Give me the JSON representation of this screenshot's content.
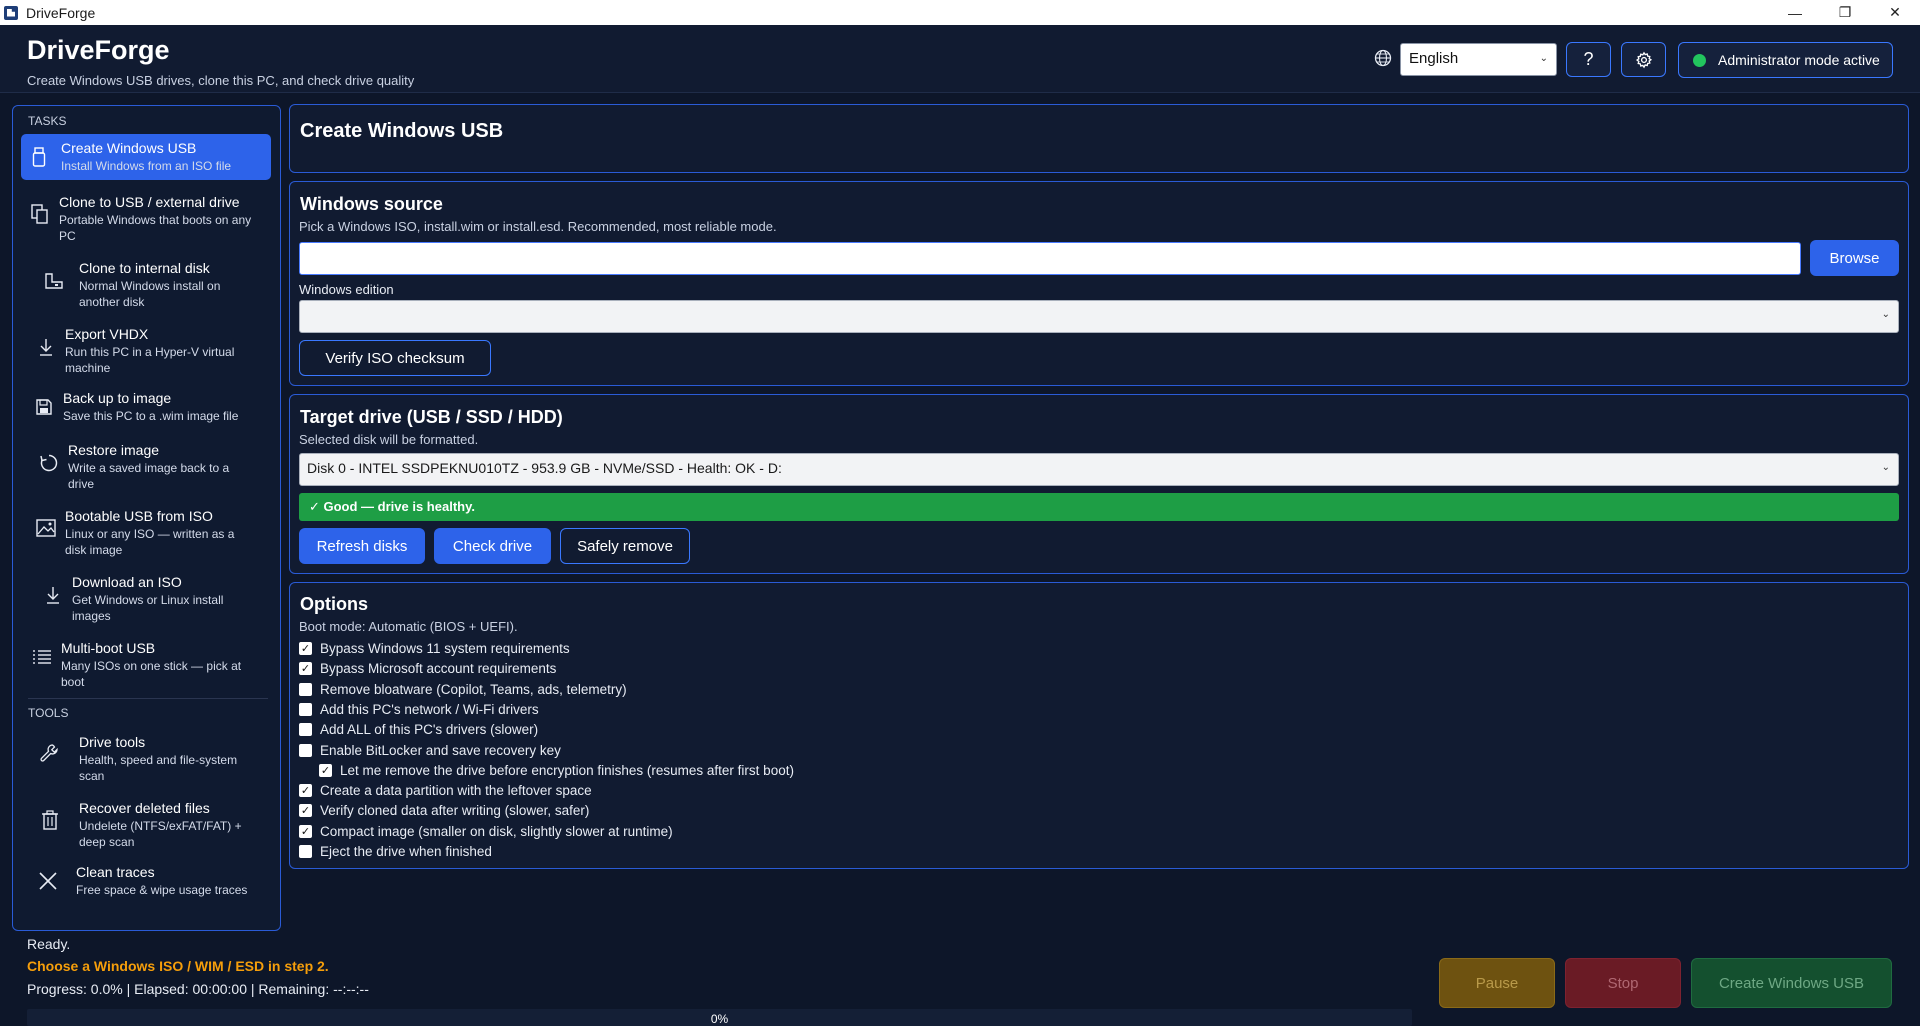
{
  "window": {
    "title": "DriveForge",
    "controls": [
      "—",
      "❐",
      "✕"
    ]
  },
  "header": {
    "app_name": "DriveForge",
    "tagline": "Create Windows USB drives, clone this PC, and check drive quality",
    "language": "English",
    "help_label": "?",
    "admin_status": "Administrator mode active",
    "admin_status_color": "#22c55e"
  },
  "sidebar": {
    "tasks_label": "TASKS",
    "tools_label": "TOOLS",
    "tasks": [
      {
        "title": "Create Windows USB",
        "desc": "Install Windows from an ISO file",
        "icon": "usb-icon",
        "active": true
      },
      {
        "title": "Clone to USB / external drive",
        "desc": "Portable Windows that boots on any PC",
        "icon": "copy-icon"
      },
      {
        "title": "Clone to internal disk",
        "desc": "Normal Windows install on another disk",
        "icon": "internal-disk-icon"
      },
      {
        "title": "Export VHDX",
        "desc": "Run this PC in a Hyper-V virtual machine",
        "icon": "download-arrow-icon"
      },
      {
        "title": "Back up to image",
        "desc": "Save this PC to a .wim image file",
        "icon": "save-icon"
      },
      {
        "title": "Restore image",
        "desc": "Write a saved image back to a drive",
        "icon": "restore-icon"
      },
      {
        "title": "Bootable USB from ISO",
        "desc": "Linux or any ISO — written as a disk image",
        "icon": "image-icon"
      },
      {
        "title": "Download an ISO",
        "desc": "Get Windows or Linux install images",
        "icon": "download-icon"
      },
      {
        "title": "Multi-boot USB",
        "desc": "Many ISOs on one stick — pick at boot",
        "icon": "list-icon"
      }
    ],
    "tools": [
      {
        "title": "Drive tools",
        "desc": "Health, speed and file-system scan",
        "icon": "wrench-icon"
      },
      {
        "title": "Recover deleted files",
        "desc": "Undelete (NTFS/exFAT/FAT) + deep scan",
        "icon": "trash-icon"
      },
      {
        "title": "Clean traces",
        "desc": "Free space & wipe usage traces",
        "icon": "close-icon"
      }
    ]
  },
  "main": {
    "page_title": "Create Windows USB",
    "source": {
      "title": "Windows source",
      "subtitle": "Pick a Windows ISO, install.wim or install.esd. Recommended, most reliable mode.",
      "path_value": "",
      "browse_label": "Browse",
      "edition_label": "Windows edition",
      "edition_value": "",
      "verify_label": "Verify ISO checksum"
    },
    "target": {
      "title": "Target drive (USB / SSD / HDD)",
      "subtitle": "Selected disk will be formatted.",
      "disk_value": "Disk 0 - INTEL SSDPEKNU010TZ - 953.9 GB - NVMe/SSD - Health: OK - D:",
      "health_text": "✓ Good — drive is healthy.",
      "health_color": "#1e9e45",
      "refresh_label": "Refresh disks",
      "check_label": "Check drive",
      "remove_label": "Safely remove"
    },
    "options": {
      "title": "Options",
      "boot_mode": "Boot mode: Automatic (BIOS + UEFI).",
      "items": [
        {
          "label": "Bypass Windows 11 system requirements",
          "checked": true,
          "indent": false
        },
        {
          "label": "Bypass Microsoft account requirements",
          "checked": true,
          "indent": false
        },
        {
          "label": "Remove bloatware (Copilot, Teams, ads, telemetry)",
          "checked": false,
          "indent": false
        },
        {
          "label": "Add this PC's network / Wi-Fi drivers",
          "checked": false,
          "indent": false
        },
        {
          "label": "Add ALL of this PC's drivers (slower)",
          "checked": false,
          "indent": false
        },
        {
          "label": "Enable BitLocker and save recovery key",
          "checked": false,
          "indent": false
        },
        {
          "label": "Let me remove the drive before encryption finishes (resumes after first boot)",
          "checked": true,
          "indent": true
        },
        {
          "label": "Create a data partition with the leftover space",
          "checked": true,
          "indent": false
        },
        {
          "label": "Verify cloned data after writing (slower, safer)",
          "checked": true,
          "indent": false
        },
        {
          "label": "Compact image (smaller on disk, slightly slower at runtime)",
          "checked": true,
          "indent": false
        },
        {
          "label": "Eject the drive when finished",
          "checked": false,
          "indent": false
        }
      ]
    }
  },
  "status": {
    "line1": "Ready.",
    "line2": "Choose a Windows ISO / WIM / ESD in step 2.",
    "line2_color": "#f59e0b",
    "line3": "Progress: 0.0% | Elapsed: 00:00:00 | Remaining: --:--:--",
    "progress_fraction": 0.0,
    "progress_label": "0%"
  },
  "actions": {
    "pause_label": "Pause",
    "stop_label": "Stop",
    "create_label": "Create Windows USB"
  }
}
